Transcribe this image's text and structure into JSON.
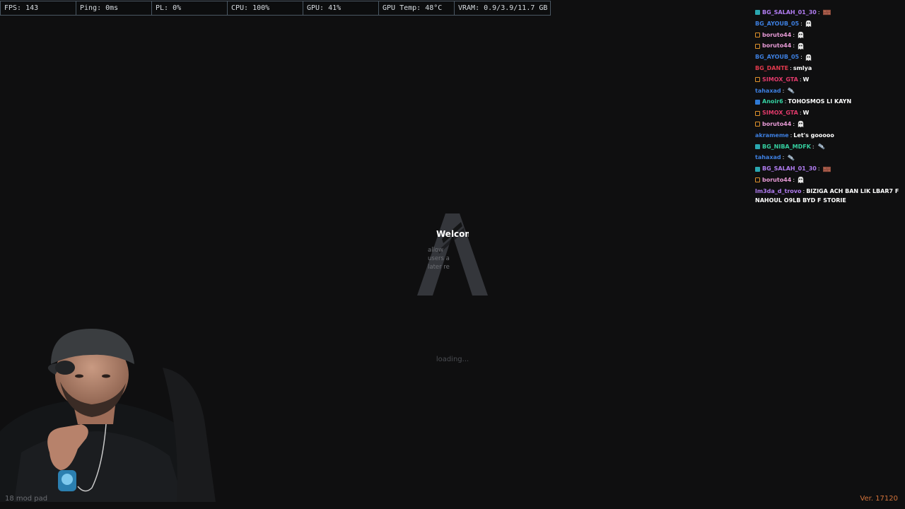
{
  "perf_overlay": {
    "cells": [
      {
        "key": "fps",
        "label": "FPS: 143"
      },
      {
        "key": "ping",
        "label": "Ping: 0ms"
      },
      {
        "key": "pl",
        "label": "PL: 0%"
      },
      {
        "key": "cpu",
        "label": "CPU: 100%"
      },
      {
        "key": "gpu",
        "label": "GPU: 41%"
      },
      {
        "key": "gpu_temp",
        "label": "GPU Temp: 48°C"
      },
      {
        "key": "vram",
        "label": "VRAM: 0.9/3.9/11.7 GB"
      }
    ]
  },
  "loading_screen": {
    "logo_title": "Welcome",
    "logo_description": "allow\nusers a\nlater re",
    "loading_label": "loading...",
    "logo_color": "#3a3c41"
  },
  "chat": {
    "messages": [
      {
        "badge": "teal",
        "user": "BG_SALAH_01_30",
        "color": "#b07cf0",
        "text": "",
        "emote": "brick-emote"
      },
      {
        "badge": "",
        "user": "BG_AYOUB_05",
        "color": "#3d7fe0",
        "text": "",
        "emote": "ghost-emote"
      },
      {
        "badge": "orange",
        "user": "boruto44",
        "color": "#e79ad5",
        "text": "",
        "emote": "ghost-emote"
      },
      {
        "badge": "orange",
        "user": "boruto44",
        "color": "#e79ad5",
        "text": "",
        "emote": "ghost-emote"
      },
      {
        "badge": "",
        "user": "BG_AYOUB_05",
        "color": "#3d7fe0",
        "text": "",
        "emote": "ghost-emote"
      },
      {
        "badge": "",
        "user": "BG_DANTE",
        "color": "#e23a4d",
        "text": "smlya",
        "emote": ""
      },
      {
        "badge": "orange",
        "user": "SIMOX_GTA",
        "color": "#e23a6b",
        "text": "W",
        "emote": ""
      },
      {
        "badge": "",
        "user": "tahaxad",
        "color": "#3d7fe0",
        "text": "",
        "emote": "satellite-emote"
      },
      {
        "badge": "blue",
        "user": "Anoir6",
        "color": "#34d0a0",
        "text": "TOHOSMOS LI KAYN",
        "emote": ""
      },
      {
        "badge": "orange",
        "user": "SIMOX_GTA",
        "color": "#e23a6b",
        "text": "W",
        "emote": ""
      },
      {
        "badge": "orange",
        "user": "boruto44",
        "color": "#e79ad5",
        "text": "",
        "emote": "ghost-emote"
      },
      {
        "badge": "",
        "user": "akrameme",
        "color": "#3d7fe0",
        "text": "Let's gooooo",
        "emote": ""
      },
      {
        "badge": "teal",
        "user": "BG_NIBA_MDFK",
        "color": "#34d0a0",
        "text": "",
        "emote": "satellite-emote"
      },
      {
        "badge": "",
        "user": "tahaxad",
        "color": "#3d7fe0",
        "text": "",
        "emote": "satellite-emote"
      },
      {
        "badge": "teal",
        "user": "BG_SALAH_01_30",
        "color": "#b07cf0",
        "text": "",
        "emote": "brick-emote"
      },
      {
        "badge": "orange",
        "user": "boruto44",
        "color": "#e79ad5",
        "text": "",
        "emote": "ghost-emote"
      }
    ],
    "last_message": {
      "user": "lm3da_d_trovo",
      "color": "#b07cf0",
      "text": "BIZIGA ACH BAN LIK LBAR7 F NAHOUL O9LB BYD F STORIE"
    }
  },
  "footer": {
    "mods_loaded": "18 mod pad",
    "version": "Ver. 17120"
  }
}
